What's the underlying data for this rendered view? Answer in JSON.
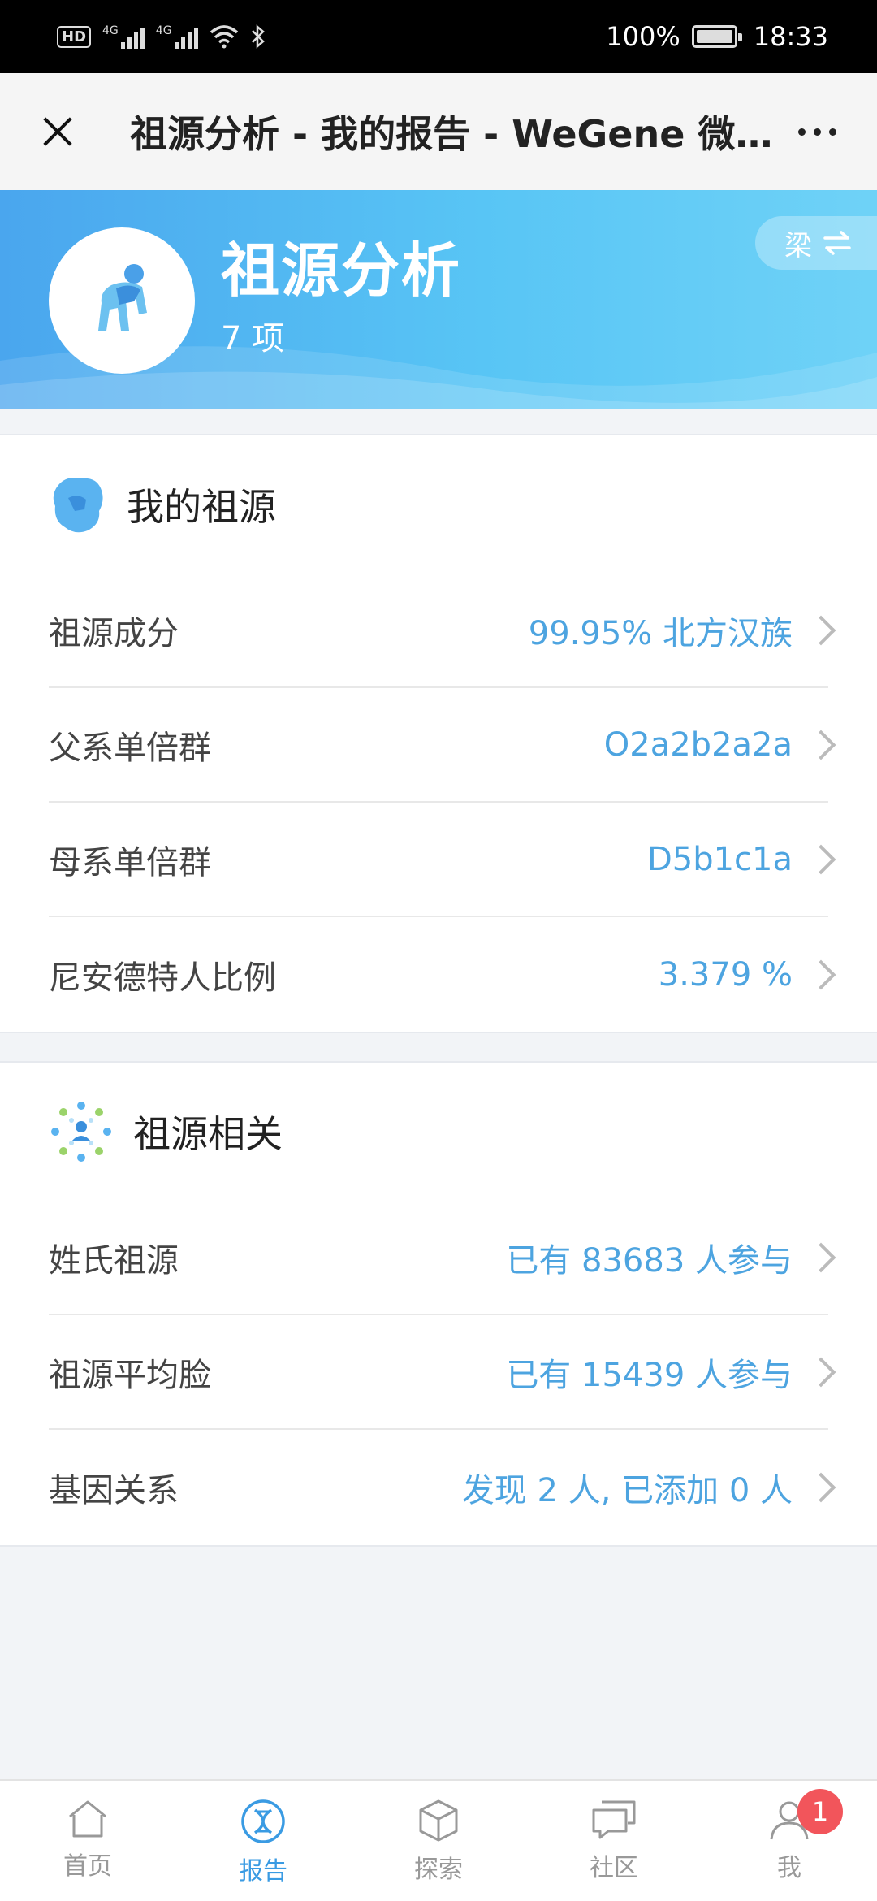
{
  "status_bar": {
    "network_1": "4G",
    "network_2": "4G",
    "battery": "100%",
    "time": "18:33"
  },
  "titlebar": {
    "title": "祖源分析 - 我的报告 - WeGene 微基因"
  },
  "banner": {
    "title": "祖源分析",
    "count": "7 项",
    "switch_label": "梁"
  },
  "my_ancestry": {
    "title": "我的祖源",
    "rows": [
      {
        "label": "祖源成分",
        "value": "99.95% 北方汉族"
      },
      {
        "label": "父系单倍群",
        "value": "O2a2b2a2a"
      },
      {
        "label": "母系单倍群",
        "value": "D5b1c1a"
      },
      {
        "label": "尼安德特人比例",
        "value": "3.379 %"
      }
    ]
  },
  "ancestry_related": {
    "title": "祖源相关",
    "rows": [
      {
        "label": "姓氏祖源",
        "value": "已有 83683 人参与"
      },
      {
        "label": "祖源平均脸",
        "value": "已有 15439 人参与"
      },
      {
        "label": "基因关系",
        "value": "发现 2 人, 已添加 0 人"
      }
    ]
  },
  "bottom_nav": {
    "items": [
      {
        "label": "首页",
        "icon": "home-icon"
      },
      {
        "label": "报告",
        "icon": "dna-icon"
      },
      {
        "label": "探索",
        "icon": "cube-icon"
      },
      {
        "label": "社区",
        "icon": "chat-icon"
      },
      {
        "label": "我",
        "icon": "user-icon"
      }
    ],
    "active_index": 1,
    "me_badge": "1"
  },
  "colors": {
    "accent": "#3a9be3",
    "value_text": "#4da4e0",
    "banner_start": "#4aa6ee",
    "banner_end": "#6fd2f7",
    "badge": "#f2555b"
  }
}
